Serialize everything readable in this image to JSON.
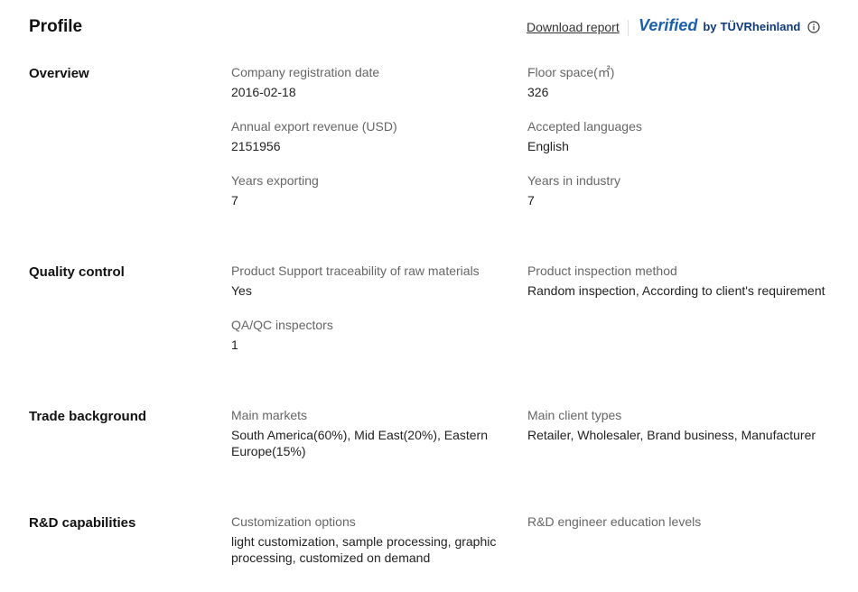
{
  "header": {
    "title": "Profile",
    "download_label": "Download report",
    "verified_word": "Verified",
    "verified_by": "by",
    "verified_org": "TÜVRheinland",
    "accent": "#1b5fa8"
  },
  "overview": {
    "title": "Overview",
    "fields": [
      {
        "label": "Company registration date",
        "value": "2016-02-18"
      },
      {
        "label": "Floor space(㎡)",
        "value": "326"
      },
      {
        "label": "Annual export revenue (USD)",
        "value": "2151956"
      },
      {
        "label": "Accepted languages",
        "value": "English"
      },
      {
        "label": "Years exporting",
        "value": "7"
      },
      {
        "label": "Years in industry",
        "value": "7"
      }
    ]
  },
  "quality": {
    "title": "Quality control",
    "fields": [
      {
        "label": "Product Support traceability of raw materials",
        "value": "Yes"
      },
      {
        "label": "Product inspection method",
        "value": "Random inspection, According to client's requirement"
      },
      {
        "label": "QA/QC inspectors",
        "value": "1"
      }
    ]
  },
  "trade": {
    "title": "Trade background",
    "fields": [
      {
        "label": "Main markets",
        "value": "South America(60%), Mid East(20%), Eastern Europe(15%)"
      },
      {
        "label": "Main client types",
        "value": "Retailer, Wholesaler, Brand business, Manufacturer"
      }
    ]
  },
  "rd": {
    "title": "R&D capabilities",
    "fields": [
      {
        "label": "Customization options",
        "value": "light customization, sample processing, graphic processing, customized on demand"
      },
      {
        "label": "R&D engineer education levels",
        "value": ""
      }
    ]
  }
}
